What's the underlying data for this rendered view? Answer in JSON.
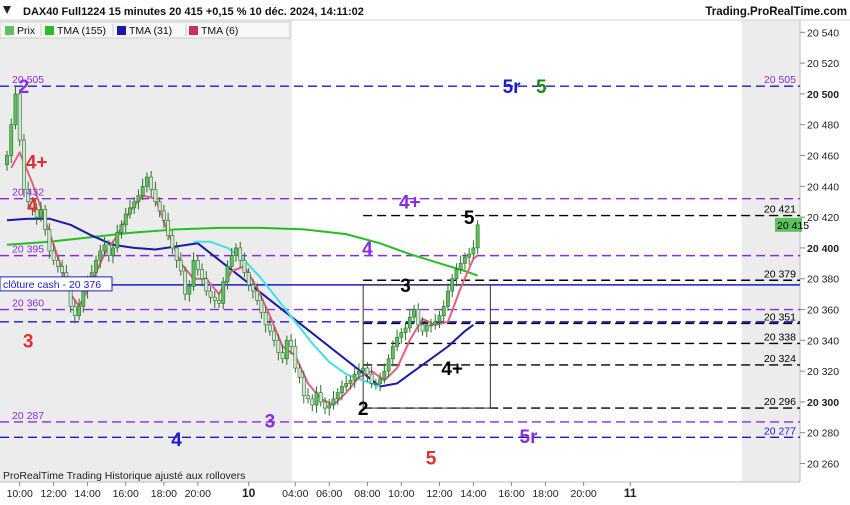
{
  "header": {
    "title": "DAX40 Full1224 15 minutes 20 415 +0,15 % 10 déc. 2024, 14:11:02",
    "brand": "Trading.ProRealTime.com"
  },
  "footer": {
    "note": "ProRealTime Trading Historique ajusté aux rollovers"
  },
  "legend": [
    {
      "label": "Prix",
      "color": "#5cc25c"
    },
    {
      "label": "TMA (155)",
      "color": "#22c022"
    },
    {
      "label": "TMA (31)",
      "color": "#1a1aa8"
    },
    {
      "label": "TMA (6)",
      "color": "#c8305a"
    }
  ],
  "price_labels": [
    {
      "text": "20 505",
      "value": 20505,
      "side": "both",
      "color": "#8a2be2"
    },
    {
      "text": "20 432",
      "value": 20432,
      "side": "left",
      "color": "#8a2be2"
    },
    {
      "text": "20 421",
      "value": 20421,
      "side": "right",
      "color": "#000000"
    },
    {
      "text": "20 395",
      "value": 20395,
      "side": "left",
      "color": "#8a2be2"
    },
    {
      "text": "20 379",
      "value": 20379,
      "side": "right",
      "color": "#000000"
    },
    {
      "text": "20 360",
      "value": 20360,
      "side": "left",
      "color": "#8a2be2"
    },
    {
      "text": "20 351",
      "value": 20351,
      "side": "right",
      "color": "#000000"
    },
    {
      "text": "20 338",
      "value": 20338,
      "side": "right",
      "color": "#000000"
    },
    {
      "text": "20 324",
      "value": 20324,
      "side": "right",
      "color": "#000000"
    },
    {
      "text": "20 296",
      "value": 20296,
      "side": "right",
      "color": "#000000"
    },
    {
      "text": "20 287",
      "value": 20287,
      "side": "left",
      "color": "#8a2be2"
    },
    {
      "text": "20 277",
      "value": 20277,
      "side": "right",
      "color": "#1a1ad0"
    }
  ],
  "cash_close_label": "clôture cash - 20 376",
  "cash_close_value": 20376,
  "current_price_label": "20 415",
  "chart_data": {
    "type": "candlestick",
    "symbol": "DAX40 Full1224",
    "timeframe": "15 minutes",
    "y_axis_ticks": [
      20260,
      20280,
      20300,
      20320,
      20340,
      20360,
      20380,
      20400,
      20420,
      20440,
      20460,
      20480,
      20500,
      20520,
      20540
    ],
    "y_axis_labels": [
      "20 260",
      "20 280",
      "20 300",
      "20 320",
      "20 340",
      "20 360",
      "20 380",
      "20 400",
      "20 420",
      "20 440",
      "20 460",
      "20 480",
      "20 500",
      "20 520",
      "20 540"
    ],
    "ylim": [
      20248,
      20548
    ],
    "x_axis_labels": [
      "10:00",
      "12:00",
      "14:00",
      "16:00",
      "18:00",
      "20:00",
      "10",
      "04:00",
      "06:00",
      "08:00",
      "10:00",
      "12:00",
      "14:00",
      "16:00",
      "18:00",
      "20:00",
      "11"
    ],
    "x_axis_bold": [
      false,
      false,
      false,
      false,
      false,
      false,
      true,
      false,
      false,
      false,
      false,
      false,
      false,
      false,
      false,
      false,
      true
    ],
    "x_axis_tick_index": [
      3,
      11,
      19,
      28,
      37,
      45,
      57,
      68,
      76,
      85,
      93,
      102,
      110,
      119,
      127,
      136,
      147
    ],
    "last_candle_index": 111,
    "closes": [
      20460,
      20480,
      20500,
      20470,
      20438,
      20430,
      20425,
      20420,
      20425,
      20412,
      20398,
      20392,
      20388,
      20384,
      20375,
      20362,
      20356,
      20362,
      20372,
      20378,
      20384,
      20392,
      20398,
      20402,
      20395,
      20400,
      20410,
      20415,
      20422,
      20426,
      20430,
      20434,
      20440,
      20446,
      20438,
      20430,
      20424,
      20418,
      20408,
      20400,
      20392,
      20385,
      20370,
      20375,
      20392,
      20386,
      20380,
      20372,
      20368,
      20366,
      20364,
      20378,
      20388,
      20395,
      20400,
      20392,
      20384,
      20376,
      20372,
      20366,
      20358,
      20350,
      20346,
      20340,
      20332,
      20328,
      20340,
      20336,
      20322,
      20316,
      20304,
      20302,
      20298,
      20306,
      20300,
      20296,
      20298,
      20302,
      20306,
      20310,
      20312,
      20314,
      20318,
      20320,
      20322,
      20318,
      20312,
      20312,
      20315,
      20320,
      20328,
      20336,
      20342,
      20345,
      20348,
      20355,
      20360,
      20350,
      20346,
      20350,
      20350,
      20352,
      20356,
      20362,
      20372,
      20380,
      20386,
      20390,
      20394,
      20396,
      20400,
      20415
    ],
    "ma_series": [
      {
        "name": "TMA (155)",
        "color": "#22c022",
        "values": [
          {
            "i": 0,
            "v": 20402
          },
          {
            "i": 10,
            "v": 20404
          },
          {
            "i": 20,
            "v": 20407
          },
          {
            "i": 30,
            "v": 20410
          },
          {
            "i": 40,
            "v": 20412
          },
          {
            "i": 50,
            "v": 20413
          },
          {
            "i": 60,
            "v": 20413
          },
          {
            "i": 70,
            "v": 20412
          },
          {
            "i": 80,
            "v": 20409
          },
          {
            "i": 88,
            "v": 20403
          },
          {
            "i": 95,
            "v": 20396
          },
          {
            "i": 102,
            "v": 20390
          },
          {
            "i": 108,
            "v": 20385
          },
          {
            "i": 111,
            "v": 20382
          }
        ]
      },
      {
        "name": "TMA (31)",
        "color": "#1a1aa8",
        "values": [
          {
            "i": 0,
            "v": 20418
          },
          {
            "i": 5,
            "v": 20419
          },
          {
            "i": 10,
            "v": 20419
          },
          {
            "i": 15,
            "v": 20415
          },
          {
            "i": 20,
            "v": 20408
          },
          {
            "i": 25,
            "v": 20402
          },
          {
            "i": 30,
            "v": 20400
          },
          {
            "i": 35,
            "v": 20399
          },
          {
            "i": 40,
            "v": 20401
          },
          {
            "i": 45,
            "v": 20403
          },
          {
            "i": 88,
            "v": 20310
          },
          {
            "i": 92,
            "v": 20312
          },
          {
            "i": 96,
            "v": 20320
          },
          {
            "i": 100,
            "v": 20328
          },
          {
            "i": 104,
            "v": 20336
          },
          {
            "i": 108,
            "v": 20346
          },
          {
            "i": 110,
            "v": 20350
          }
        ]
      },
      {
        "name": "TMA (31) cyan",
        "color": "#40e0e8",
        "values": [
          {
            "i": 44,
            "v": 20404
          },
          {
            "i": 48,
            "v": 20404
          },
          {
            "i": 52,
            "v": 20400
          },
          {
            "i": 56,
            "v": 20392
          },
          {
            "i": 60,
            "v": 20380
          },
          {
            "i": 64,
            "v": 20366
          },
          {
            "i": 68,
            "v": 20352
          },
          {
            "i": 72,
            "v": 20338
          },
          {
            "i": 76,
            "v": 20326
          },
          {
            "i": 80,
            "v": 20318
          },
          {
            "i": 84,
            "v": 20314
          },
          {
            "i": 88,
            "v": 20310
          }
        ]
      },
      {
        "name": "TMA (6)",
        "color": "#e26080",
        "values": [
          {
            "i": 1,
            "v": 20452
          },
          {
            "i": 3,
            "v": 20462
          },
          {
            "i": 6,
            "v": 20442
          },
          {
            "i": 9,
            "v": 20418
          },
          {
            "i": 12,
            "v": 20394
          },
          {
            "i": 15,
            "v": 20370
          },
          {
            "i": 17,
            "v": 20362
          },
          {
            "i": 20,
            "v": 20378
          },
          {
            "i": 23,
            "v": 20396
          },
          {
            "i": 26,
            "v": 20408
          },
          {
            "i": 29,
            "v": 20424
          },
          {
            "i": 32,
            "v": 20434
          },
          {
            "i": 35,
            "v": 20432
          },
          {
            "i": 38,
            "v": 20410
          },
          {
            "i": 41,
            "v": 20390
          },
          {
            "i": 44,
            "v": 20380
          },
          {
            "i": 47,
            "v": 20380
          },
          {
            "i": 50,
            "v": 20370
          },
          {
            "i": 53,
            "v": 20385
          },
          {
            "i": 56,
            "v": 20388
          },
          {
            "i": 59,
            "v": 20374
          },
          {
            "i": 62,
            "v": 20356
          },
          {
            "i": 65,
            "v": 20336
          },
          {
            "i": 68,
            "v": 20330
          },
          {
            "i": 71,
            "v": 20312
          },
          {
            "i": 74,
            "v": 20302
          },
          {
            "i": 77,
            "v": 20298
          },
          {
            "i": 80,
            "v": 20306
          },
          {
            "i": 83,
            "v": 20316
          },
          {
            "i": 86,
            "v": 20320
          },
          {
            "i": 89,
            "v": 20314
          },
          {
            "i": 92,
            "v": 20322
          },
          {
            "i": 95,
            "v": 20340
          },
          {
            "i": 98,
            "v": 20354
          },
          {
            "i": 101,
            "v": 20350
          },
          {
            "i": 104,
            "v": 20352
          },
          {
            "i": 107,
            "v": 20374
          },
          {
            "i": 110,
            "v": 20393
          },
          {
            "i": 111,
            "v": 20395
          }
        ]
      }
    ],
    "horizontal_lines": [
      {
        "value": 20505,
        "color": "#1a1ad0",
        "style": "dashed",
        "from": 0
      },
      {
        "value": 20432,
        "color": "#8a2be2",
        "style": "dashed",
        "from": 0
      },
      {
        "value": 20421,
        "color": "#000000",
        "style": "dashed",
        "from": 84
      },
      {
        "value": 20395,
        "color": "#8a2be2",
        "style": "dashed",
        "from": 0
      },
      {
        "value": 20379,
        "color": "#000000",
        "style": "dashed",
        "from": 84
      },
      {
        "value": 20376,
        "color": "#1a1ad0",
        "style": "solid",
        "from": 0
      },
      {
        "value": 20360,
        "color": "#8a2be2",
        "style": "dashed",
        "from": 0
      },
      {
        "value": 20352,
        "color": "#1a1ad0",
        "style": "dashed",
        "from": 0
      },
      {
        "value": 20351,
        "color": "#000000",
        "style": "dashed",
        "from": 84
      },
      {
        "value": 20338,
        "color": "#000000",
        "style": "dashed",
        "from": 84
      },
      {
        "value": 20324,
        "color": "#000000",
        "style": "dashed",
        "from": 84
      },
      {
        "value": 20296,
        "color": "#000000",
        "style": "dashed",
        "from": 84
      },
      {
        "value": 20287,
        "color": "#8a2be2",
        "style": "dashed",
        "from": 0
      },
      {
        "value": 20277,
        "color": "#1a1ad0",
        "style": "dashed",
        "from": 0
      }
    ],
    "box": {
      "from": 84,
      "to": 114,
      "top": 20376,
      "bottom": 20296
    },
    "annotations": [
      {
        "text": "2",
        "color": "#8a2be2",
        "i": 4,
        "v": 20505
      },
      {
        "text": "4+",
        "color": "#e03030",
        "i": 7,
        "v": 20456
      },
      {
        "text": "4",
        "color": "#e03030",
        "i": 6,
        "v": 20428
      },
      {
        "text": "3",
        "color": "#e03030",
        "i": 5,
        "v": 20340
      },
      {
        "text": "3",
        "color": "#8a2be2",
        "i": 62,
        "v": 20288
      },
      {
        "text": "4",
        "color": "#1a1ad0",
        "i": 40,
        "v": 20276
      },
      {
        "text": "4+",
        "color": "#8a2be2",
        "i": 95,
        "v": 20430
      },
      {
        "text": "4",
        "color": "#8a2be2",
        "i": 85,
        "v": 20400
      },
      {
        "text": "5",
        "color": "#000000",
        "i": 109,
        "v": 20420
      },
      {
        "text": "3",
        "color": "#000000",
        "i": 94,
        "v": 20376
      },
      {
        "text": "2",
        "color": "#000000",
        "i": 84,
        "v": 20296
      },
      {
        "text": "4+",
        "color": "#000000",
        "i": 105,
        "v": 20322
      },
      {
        "text": "5",
        "color": "#e03030",
        "i": 100,
        "v": 20264
      },
      {
        "text": "5r",
        "color": "#1a1ad0",
        "i": 119,
        "v": 20505
      },
      {
        "text": "5",
        "color": "#1a8a1a",
        "i": 126,
        "v": 20505
      },
      {
        "text": "5r",
        "color": "#8a2be2",
        "i": 123,
        "v": 20278
      }
    ]
  }
}
